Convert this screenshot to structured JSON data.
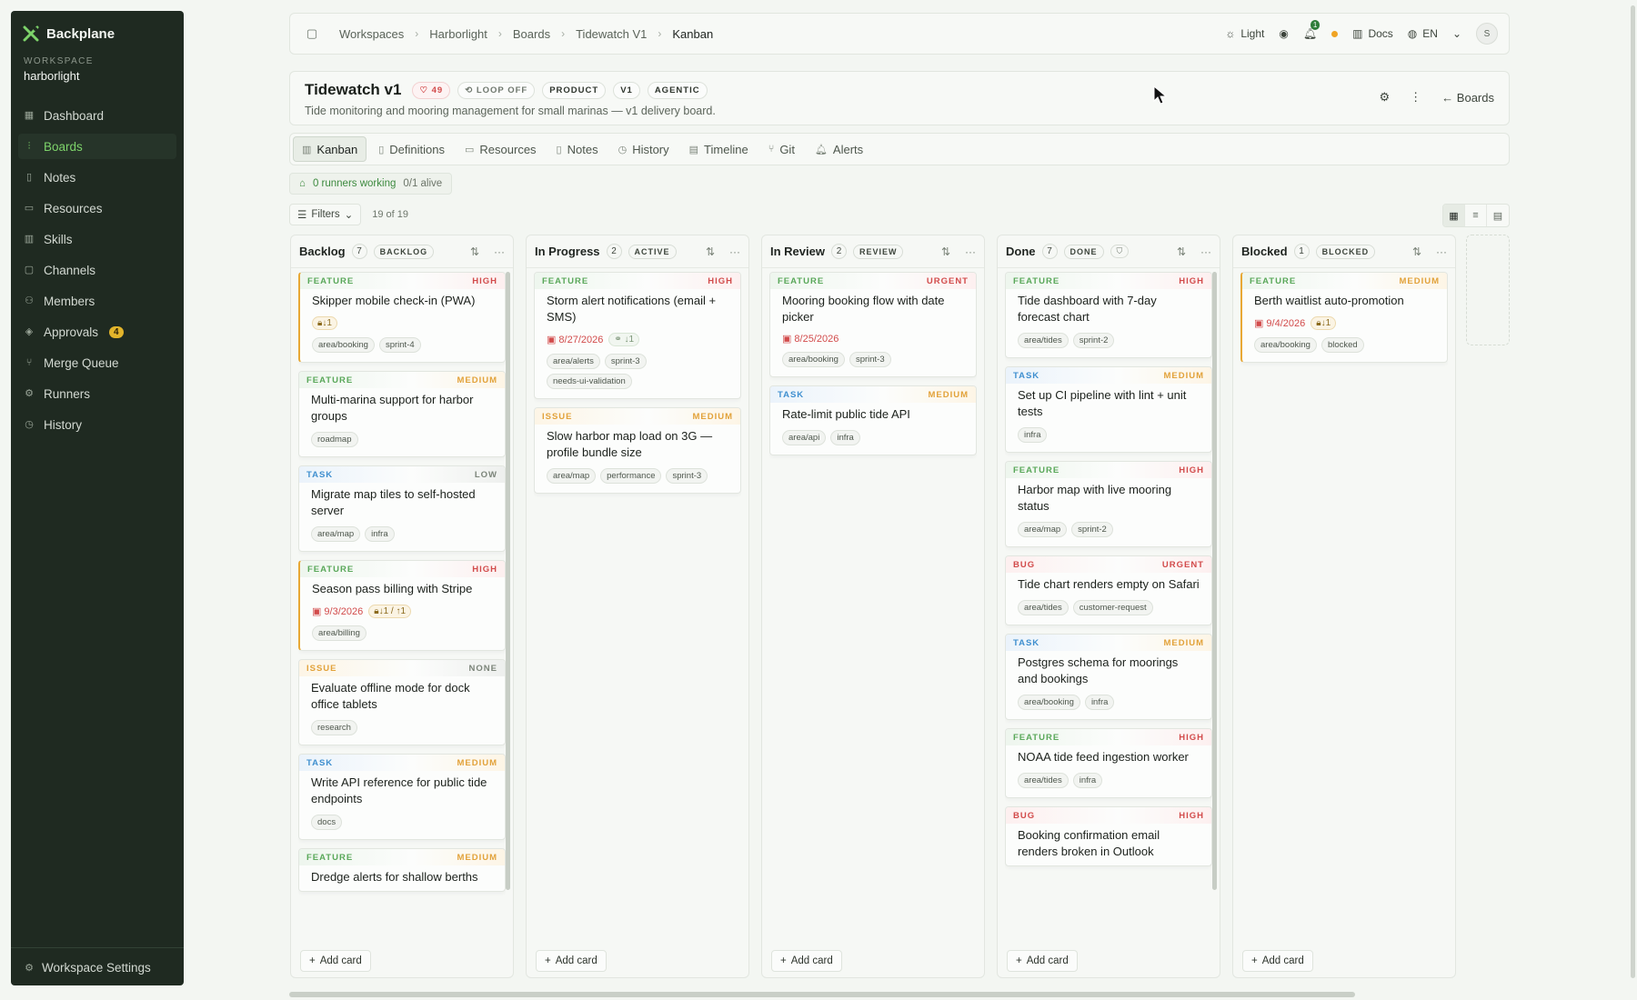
{
  "sidebar": {
    "brand": "Backplane",
    "workspace_label": "WORKSPACE",
    "workspace_name": "harborlight",
    "items": [
      {
        "label": "Dashboard",
        "icon": "grid-icon"
      },
      {
        "label": "Boards",
        "icon": "kanban-icon",
        "active": true
      },
      {
        "label": "Notes",
        "icon": "file-icon"
      },
      {
        "label": "Resources",
        "icon": "folder-icon"
      },
      {
        "label": "Skills",
        "icon": "book-icon"
      },
      {
        "label": "Channels",
        "icon": "chat-icon"
      },
      {
        "label": "Members",
        "icon": "users-icon"
      },
      {
        "label": "Approvals",
        "icon": "shield-check-icon",
        "badge": "4"
      },
      {
        "label": "Merge Queue",
        "icon": "git-merge-icon"
      },
      {
        "label": "Runners",
        "icon": "runner-icon"
      },
      {
        "label": "History",
        "icon": "clock-icon"
      }
    ],
    "footer_label": "Workspace Settings"
  },
  "topbar": {
    "breadcrumbs": [
      "Workspaces",
      "Harborlight",
      "Boards",
      "Tidewatch V1",
      "Kanban"
    ],
    "theme_label": "Light",
    "notif_count": "1",
    "docs_label": "Docs",
    "lang_label": "EN",
    "avatar_initial": "S"
  },
  "board": {
    "title": "Tidewatch v1",
    "heart_count": "49",
    "loop_label": "LOOP OFF",
    "tags": [
      "PRODUCT",
      "V1",
      "AGENTIC"
    ],
    "description": "Tide monitoring and mooring management for small marinas — v1 delivery board.",
    "back_label": "Boards"
  },
  "tabs": [
    "Kanban",
    "Definitions",
    "Resources",
    "Notes",
    "History",
    "Timeline",
    "Git",
    "Alerts"
  ],
  "runners": {
    "working": "0 runners working",
    "alive": "0/1 alive"
  },
  "filters": {
    "label": "Filters",
    "count": "19 of 19"
  },
  "add_card_label": "Add card",
  "accent_color": "#7dd36a",
  "columns": [
    {
      "title": "Backlog",
      "count": "7",
      "tag": "BACKLOG",
      "cards": [
        {
          "type": "FEATURE",
          "priority": "HIGH",
          "title": "Skipper mobile check-in (PWA)",
          "dep": "↓1",
          "labels": [
            "area/booking",
            "sprint-4"
          ],
          "accent": true
        },
        {
          "type": "FEATURE",
          "priority": "MEDIUM",
          "title": "Multi-marina support for harbor groups",
          "labels": [
            "roadmap"
          ]
        },
        {
          "type": "TASK",
          "priority": "LOW",
          "title": "Migrate map tiles to self-hosted server",
          "labels": [
            "area/map",
            "infra"
          ]
        },
        {
          "type": "FEATURE",
          "priority": "HIGH",
          "title": "Season pass billing with Stripe",
          "date": "9/3/2026",
          "dep": "↓1 / ↑1",
          "labels": [
            "area/billing"
          ],
          "accent": true
        },
        {
          "type": "ISSUE",
          "priority": "NONE",
          "title": "Evaluate offline mode for dock office tablets",
          "labels": [
            "research"
          ]
        },
        {
          "type": "TASK",
          "priority": "MEDIUM",
          "title": "Write API reference for public tide endpoints",
          "labels": [
            "docs"
          ]
        },
        {
          "type": "FEATURE",
          "priority": "MEDIUM",
          "title": "Dredge alerts for shallow berths",
          "labels": []
        }
      ]
    },
    {
      "title": "In Progress",
      "count": "2",
      "tag": "ACTIVE",
      "cards": [
        {
          "type": "FEATURE",
          "priority": "HIGH",
          "title": "Storm alert notifications (email + SMS)",
          "date": "8/27/2026",
          "dep": "↓1",
          "dep_link": true,
          "labels": [
            "area/alerts",
            "sprint-3",
            "needs-ui-validation"
          ]
        },
        {
          "type": "ISSUE",
          "priority": "MEDIUM",
          "title": "Slow harbor map load on 3G — profile bundle size",
          "labels": [
            "area/map",
            "performance",
            "sprint-3"
          ]
        }
      ]
    },
    {
      "title": "In Review",
      "count": "2",
      "tag": "REVIEW",
      "cards": [
        {
          "type": "FEATURE",
          "priority": "URGENT",
          "title": "Mooring booking flow with date picker",
          "date": "8/25/2026",
          "labels": [
            "area/booking",
            "sprint-3"
          ]
        },
        {
          "type": "TASK",
          "priority": "MEDIUM",
          "title": "Rate-limit public tide API",
          "labels": [
            "area/api",
            "infra"
          ]
        }
      ]
    },
    {
      "title": "Done",
      "count": "7",
      "tag": "DONE",
      "shield": true,
      "cards": [
        {
          "type": "FEATURE",
          "priority": "HIGH",
          "title": "Tide dashboard with 7-day forecast chart",
          "labels": [
            "area/tides",
            "sprint-2"
          ]
        },
        {
          "type": "TASK",
          "priority": "MEDIUM",
          "title": "Set up CI pipeline with lint + unit tests",
          "labels": [
            "infra"
          ]
        },
        {
          "type": "FEATURE",
          "priority": "HIGH",
          "title": "Harbor map with live mooring status",
          "labels": [
            "area/map",
            "sprint-2"
          ]
        },
        {
          "type": "BUG",
          "priority": "URGENT",
          "title": "Tide chart renders empty on Safari",
          "labels": [
            "area/tides",
            "customer-request"
          ]
        },
        {
          "type": "TASK",
          "priority": "MEDIUM",
          "title": "Postgres schema for moorings and bookings",
          "labels": [
            "area/booking",
            "infra"
          ]
        },
        {
          "type": "FEATURE",
          "priority": "HIGH",
          "title": "NOAA tide feed ingestion worker",
          "labels": [
            "area/tides",
            "infra"
          ]
        },
        {
          "type": "BUG",
          "priority": "HIGH",
          "title": "Booking confirmation email renders broken in Outlook",
          "labels": []
        }
      ]
    },
    {
      "title": "Blocked",
      "count": "1",
      "tag": "BLOCKED",
      "cards": [
        {
          "type": "FEATURE",
          "priority": "MEDIUM",
          "title": "Berth waitlist auto-promotion",
          "date": "9/4/2026",
          "dep": "↓1",
          "labels": [
            "area/booking",
            "blocked"
          ],
          "accent": true
        }
      ]
    }
  ]
}
